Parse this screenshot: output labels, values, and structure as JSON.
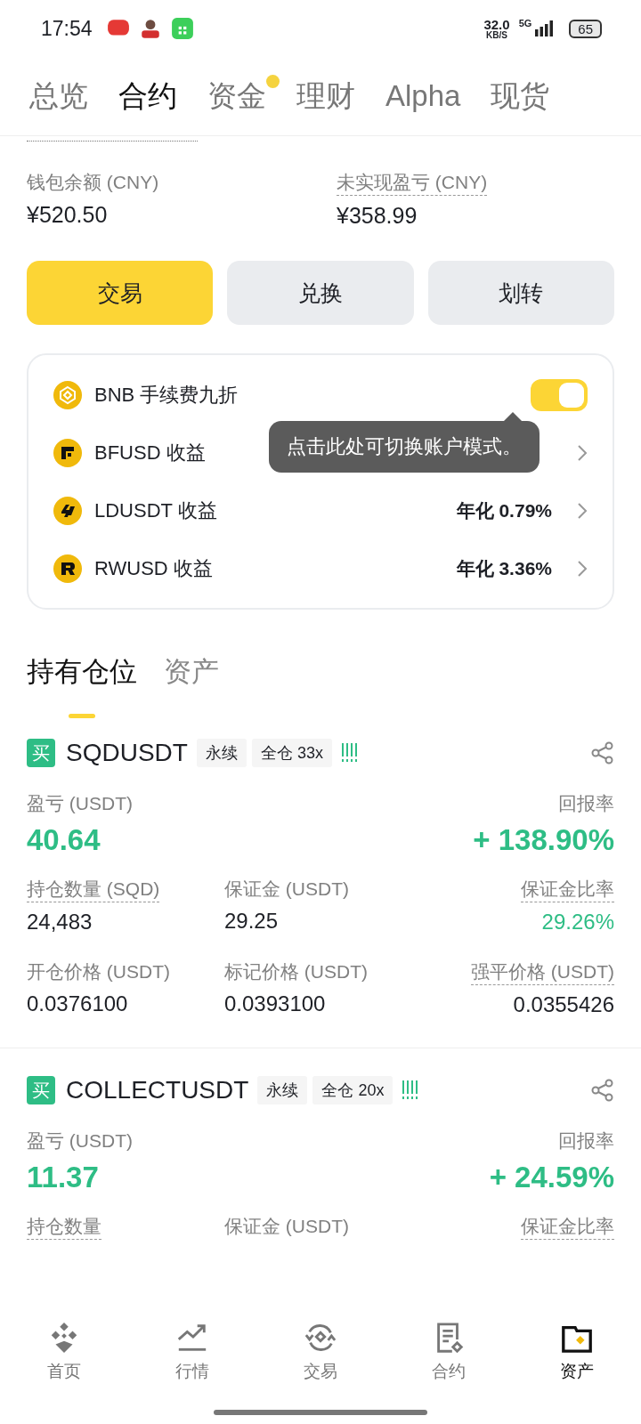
{
  "status_bar": {
    "time": "17:54",
    "speed": "32.0",
    "speed_unit": "KB/S",
    "network": "5G",
    "battery": "65"
  },
  "tabs": [
    {
      "label": "总览",
      "selected": false,
      "dot": false
    },
    {
      "label": "合约",
      "selected": true,
      "dot": false
    },
    {
      "label": "资金",
      "selected": false,
      "dot": true
    },
    {
      "label": "理财",
      "selected": false,
      "dot": false
    },
    {
      "label": "Alpha",
      "selected": false,
      "dot": false
    },
    {
      "label": "现货",
      "selected": false,
      "dot": false
    }
  ],
  "balances": [
    {
      "label": "钱包余额 (CNY)",
      "value": "¥520.50",
      "dotted": false
    },
    {
      "label": "未实现盈亏 (CNY)",
      "value": "¥358.99",
      "dotted": true
    }
  ],
  "actions": [
    {
      "label": "交易",
      "primary": true
    },
    {
      "label": "兑换",
      "primary": false
    },
    {
      "label": "划转",
      "primary": false
    }
  ],
  "earn_card": {
    "rows": [
      {
        "kind": "toggle",
        "label": "BNB 手续费九折",
        "on": true
      },
      {
        "kind": "link",
        "label": "BFUSD 收益"
      },
      {
        "kind": "link",
        "label": "LDUSDT 收益",
        "value": "年化 0.79%"
      },
      {
        "kind": "link",
        "label": "RWUSD 收益",
        "value": "年化 3.36%"
      }
    ],
    "tooltip": "点击此处可切换账户模式。"
  },
  "section_tabs": [
    {
      "label": "持有仓位",
      "selected": true
    },
    {
      "label": "资产",
      "selected": false
    }
  ],
  "positions": [
    {
      "side": "买",
      "symbol": "SQDUSDT",
      "tags": [
        "永续",
        "全仓 33x"
      ],
      "pnl_label": "盈亏 (USDT)",
      "pnl": "40.64",
      "roe_label": "回报率",
      "roe": "+ 138.90%",
      "stats": [
        {
          "label": "持仓数量 (SQD)",
          "value": "24,483",
          "dotted": true,
          "green": false
        },
        {
          "label": "保证金 (USDT)",
          "value": "29.25",
          "dotted": false,
          "green": false
        },
        {
          "label": "保证金比率",
          "value": "29.26%",
          "dotted": true,
          "green": true
        },
        {
          "label": "开仓价格 (USDT)",
          "value": "0.0376100",
          "dotted": false,
          "green": false
        },
        {
          "label": "标记价格 (USDT)",
          "value": "0.0393100",
          "dotted": false,
          "green": false
        },
        {
          "label": "强平价格 (USDT)",
          "value": "0.0355426",
          "dotted": true,
          "green": false
        }
      ]
    },
    {
      "side": "买",
      "symbol": "COLLECTUSDT",
      "tags": [
        "永续",
        "全仓 20x"
      ],
      "pnl_label": "盈亏 (USDT)",
      "pnl": "11.37",
      "roe_label": "回报率",
      "roe": "+ 24.59%",
      "stats": [
        {
          "label": "持仓数量",
          "dotted": true
        },
        {
          "label": "保证金 (USDT)",
          "dotted": false
        },
        {
          "label": "保证金比率",
          "dotted": true
        }
      ]
    }
  ],
  "bottom_nav": [
    {
      "label": "首页",
      "selected": false
    },
    {
      "label": "行情",
      "selected": false
    },
    {
      "label": "交易",
      "selected": false
    },
    {
      "label": "合约",
      "selected": false
    },
    {
      "label": "资产",
      "selected": true
    }
  ]
}
